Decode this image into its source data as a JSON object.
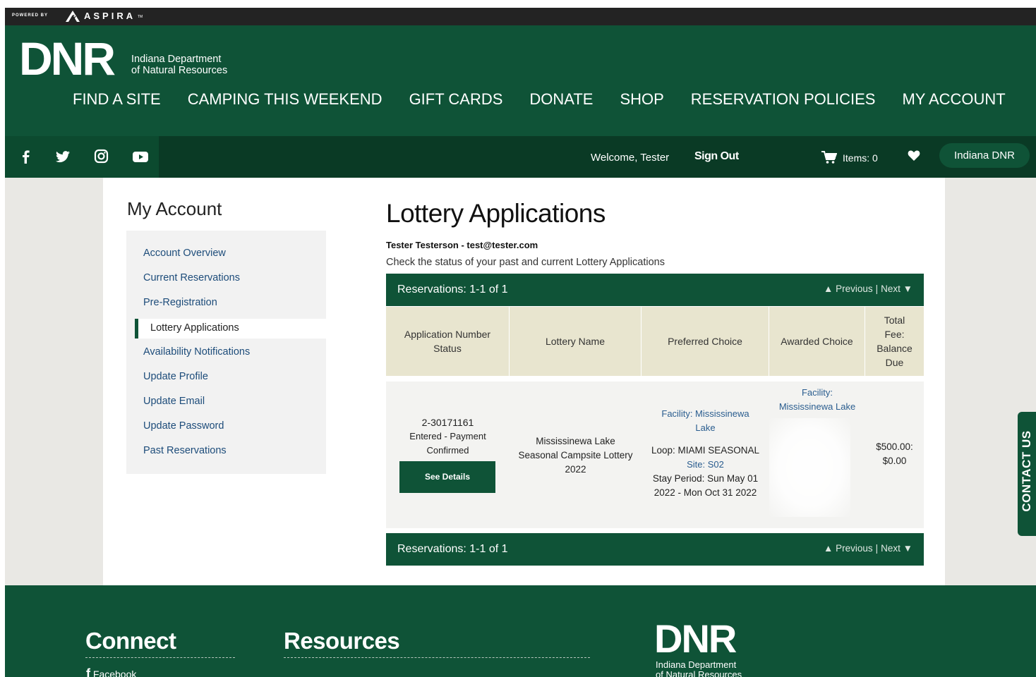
{
  "topbar": {
    "powered_by": "POWERED BY",
    "brand": "ASPIRA",
    "tm": "TM"
  },
  "header": {
    "logo": "DNR",
    "logo_line1": "Indiana Department",
    "logo_line2": "of Natural Resources",
    "nav": [
      "FIND A SITE",
      "CAMPING THIS WEEKEND",
      "GIFT CARDS",
      "DONATE",
      "SHOP",
      "RESERVATION POLICIES",
      "MY ACCOUNT"
    ]
  },
  "subbar": {
    "social_icons": [
      "facebook-icon",
      "twitter-icon",
      "instagram-icon",
      "youtube-icon"
    ],
    "welcome": "Welcome, Tester",
    "sign_out": "Sign Out",
    "items": "Items: 0",
    "indiana_dnr": "Indiana DNR"
  },
  "sidebar": {
    "title": "My Account",
    "items": [
      "Account Overview",
      "Current Reservations",
      "Pre-Registration",
      "Lottery Applications",
      "Availability Notifications",
      "Update Profile",
      "Update Email",
      "Update Password",
      "Past Reservations"
    ],
    "active": "Lottery Applications"
  },
  "main": {
    "title": "Lottery Applications",
    "user_line": "Tester Testerson - test@tester.com",
    "description": "Check the status of your past and current Lottery Applications",
    "res_count": "Reservations: 1-1 of 1",
    "previous": "▲ Previous",
    "divider": "|",
    "next": "Next ▼",
    "table": {
      "headers": {
        "app_line1": "Application Number",
        "app_line2": "Status",
        "lottery": "Lottery Name",
        "preferred": "Preferred Choice",
        "awarded": "Awarded Choice",
        "fee_line1": "Total",
        "fee_line2": "Fee:",
        "fee_line3": "Balance",
        "fee_line4": "Due"
      },
      "row": {
        "app_number": "2-30171161",
        "status_line1": "Entered - Payment",
        "status_line2": "Confirmed",
        "see_details": "See Details",
        "lottery_line1": "Mississinewa Lake",
        "lottery_line2": "Seasonal Campsite Lottery",
        "lottery_line3": "2022",
        "pref_facility_line1": "Facility: Mississinewa",
        "pref_facility_line2": "Lake",
        "pref_loop": "Loop: MIAMI SEASONAL",
        "pref_site": "Site: S02",
        "pref_stay_line1": "Stay Period: Sun May 01",
        "pref_stay_line2": "2022 - Mon Oct 31 2022",
        "award_line1": "Facility:",
        "award_line2": "Mississinewa Lake",
        "total_fee": "$500.00:",
        "balance_due": "$0.00"
      }
    }
  },
  "contact_tab": "CONTACT US",
  "footer": {
    "connect": "Connect",
    "resources": "Resources",
    "facebook": "Facebook",
    "logo": "DNR",
    "logo_line1": "Indiana Department",
    "logo_line2": "of Natural Resources"
  },
  "colors": {
    "brand_green": "#0f5337",
    "dark_green": "#0a3a25",
    "table_header": "#e8e5cf",
    "link_blue": "#2a5d8f"
  }
}
